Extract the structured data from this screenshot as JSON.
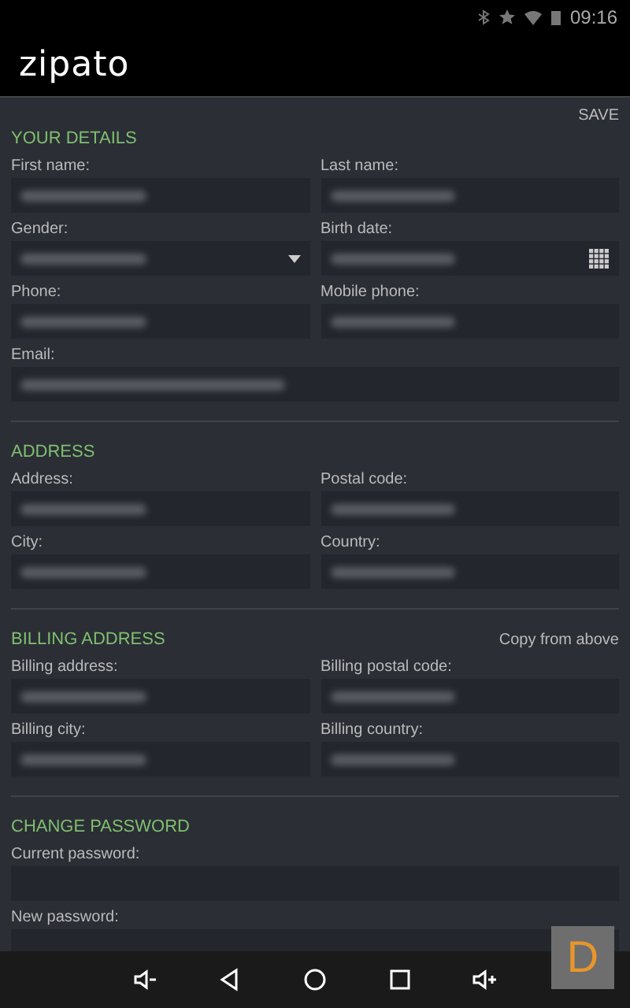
{
  "status_bar": {
    "time": "09:16"
  },
  "header": {
    "logo": "zipato"
  },
  "save": "SAVE",
  "sections": [
    {
      "title": "YOUR DETAILS",
      "fields": [
        {
          "label": "First name:",
          "kind": "text",
          "full_width": false,
          "redacted": true
        },
        {
          "label": "Last name:",
          "kind": "text",
          "full_width": false,
          "redacted": true
        },
        {
          "label": "Gender:",
          "kind": "select",
          "full_width": false,
          "redacted": true
        },
        {
          "label": "Birth date:",
          "kind": "date",
          "full_width": false,
          "redacted": true
        },
        {
          "label": "Phone:",
          "kind": "text",
          "full_width": false,
          "redacted": true
        },
        {
          "label": "Mobile phone:",
          "kind": "text",
          "full_width": false,
          "redacted": true
        },
        {
          "label": "Email:",
          "kind": "text",
          "full_width": true,
          "redacted": true
        }
      ]
    },
    {
      "title": "ADDRESS",
      "fields": [
        {
          "label": "Address:",
          "kind": "text",
          "full_width": false,
          "redacted": true
        },
        {
          "label": "Postal code:",
          "kind": "text",
          "full_width": false,
          "redacted": true
        },
        {
          "label": "City:",
          "kind": "text",
          "full_width": false,
          "redacted": true
        },
        {
          "label": "Country:",
          "kind": "text",
          "full_width": false,
          "redacted": true
        }
      ]
    },
    {
      "title": "BILLING ADDRESS",
      "action": "Copy from above",
      "fields": [
        {
          "label": "Billing address:",
          "kind": "text",
          "full_width": false,
          "redacted": true
        },
        {
          "label": "Billing postal code:",
          "kind": "text",
          "full_width": false,
          "redacted": true
        },
        {
          "label": "Billing city:",
          "kind": "text",
          "full_width": false,
          "redacted": true
        },
        {
          "label": "Billing country:",
          "kind": "text",
          "full_width": false,
          "redacted": true
        }
      ]
    },
    {
      "title": "CHANGE PASSWORD",
      "fields": [
        {
          "label": "Current password:",
          "kind": "text",
          "full_width": true,
          "redacted": false
        },
        {
          "label": "New password:",
          "kind": "text",
          "full_width": true,
          "redacted": false
        }
      ]
    }
  ],
  "overlay_button": "D"
}
